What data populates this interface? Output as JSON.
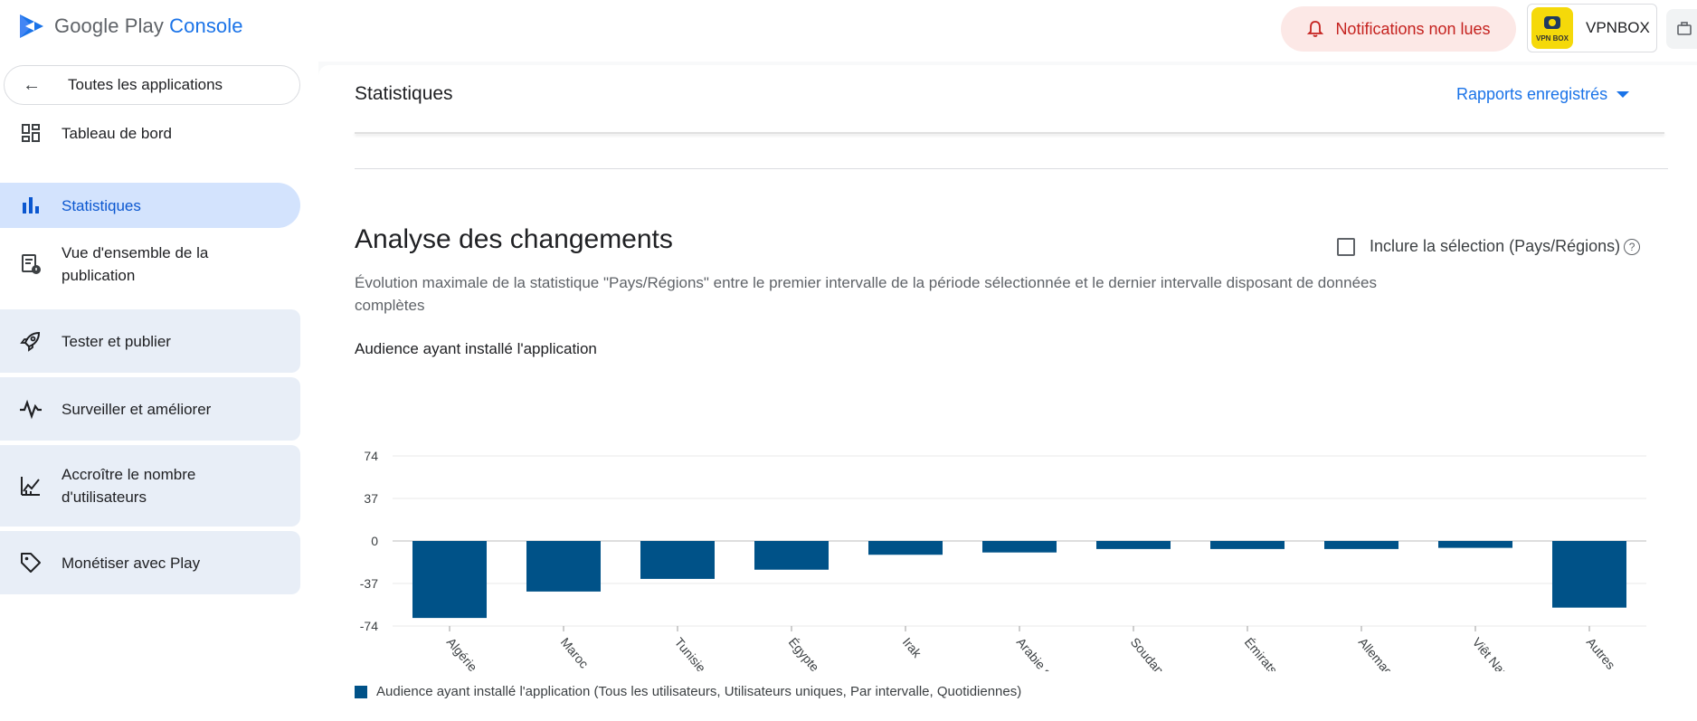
{
  "app": {
    "logo_brand": "Google Play",
    "logo_product": "Console",
    "notifications_label": "Notifications non lues",
    "account_name": "VPNBOX",
    "account_icon_text": "VPN BOX"
  },
  "sidebar": {
    "back_label": "Toutes les applications",
    "items": [
      {
        "label": "Tableau de bord",
        "icon": "dashboard-icon"
      },
      {
        "label": "Statistiques",
        "icon": "bar-chart-icon",
        "active": true
      },
      {
        "label": "Vue d'ensemble de la publication",
        "icon": "publication-overview-icon"
      },
      {
        "label": "Tester et publier",
        "icon": "rocket-icon"
      },
      {
        "label": "Surveiller et améliorer",
        "icon": "pulse-icon"
      },
      {
        "label": "Accroître le nombre d'utilisateurs",
        "icon": "growth-icon"
      },
      {
        "label": "Monétiser avec Play",
        "icon": "tag-icon"
      }
    ]
  },
  "main": {
    "page_title": "Statistiques",
    "saved_reports_label": "Rapports enregistrés",
    "section_title": "Analyse des changements",
    "include_label": "Inclure la sélection (Pays/Régions)",
    "include_checked": false,
    "description": "Évolution maximale de la statistique \"Pays/Régions\" entre le premier intervalle de la période sélectionnée et le dernier intervalle disposant de données complètes",
    "chart_title": "Audience ayant installé l'application",
    "legend_label": "Audience ayant installé l'application (Tous les utilisateurs, Utilisateurs uniques, Par intervalle, Quotidiennes)"
  },
  "chart_data": {
    "type": "bar",
    "title": "Audience ayant installé l'application",
    "categories": [
      "Algérie",
      "Maroc",
      "Tunisie",
      "Égypte",
      "Irak",
      "Arabie saoudite",
      "Soudan",
      "Émirats arabes ...",
      "Allemagne",
      "Viêt Nam",
      "Autres"
    ],
    "series": [
      {
        "name": "Audience ayant installé l'application (Tous les utilisateurs, Utilisateurs uniques, Par intervalle, Quotidiennes)",
        "values": [
          -67,
          -44,
          -33,
          -25,
          -12,
          -10,
          -7,
          -7,
          -7,
          -6,
          -58
        ]
      }
    ],
    "yticks": [
      74,
      37,
      0,
      -37,
      -74
    ],
    "ylim": [
      -74,
      74
    ],
    "grid": true,
    "legend_position": "bottom-left",
    "color": "#005288"
  }
}
